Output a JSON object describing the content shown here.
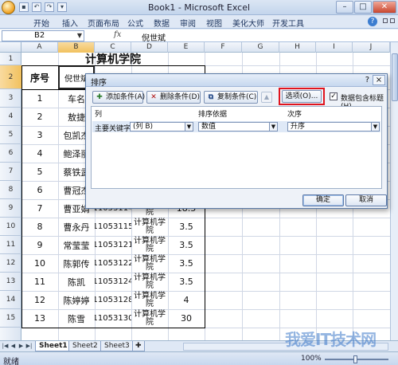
{
  "window": {
    "title": "Book1 - Microsoft Excel"
  },
  "ribbon": {
    "tabs": [
      "开始",
      "插入",
      "页面布局",
      "公式",
      "数据",
      "审阅",
      "视图",
      "美化大师",
      "开发工具"
    ]
  },
  "formula_bar": {
    "name_box": "B2",
    "fx": "fx",
    "value": "倪世斌"
  },
  "columns": [
    "A",
    "B",
    "C",
    "D",
    "E",
    "F",
    "G",
    "H",
    "I",
    "J"
  ],
  "rows": [
    "1",
    "2",
    "3",
    "4",
    "5",
    "6",
    "7",
    "8",
    "9",
    "10",
    "11",
    "12",
    "13",
    "14",
    "15"
  ],
  "sheet": {
    "title": "计算机学院",
    "header": [
      "序号",
      "倪世斌"
    ],
    "data_rows": [
      [
        "1",
        "车名",
        "",
        "",
        ""
      ],
      [
        "2",
        "敖捷",
        "",
        "",
        ""
      ],
      [
        "3",
        "包凯杰",
        "",
        "",
        ""
      ],
      [
        "4",
        "鲍泽丽",
        "",
        "",
        ""
      ],
      [
        "5",
        "蔡铁武",
        "",
        "",
        ""
      ],
      [
        "6",
        "曹冠杰",
        "",
        "",
        ""
      ],
      [
        "7",
        "曹亚娟",
        "11053114",
        "计算机学院",
        "18.5"
      ],
      [
        "8",
        "曹永丹",
        "11053115",
        "计算机学院",
        "3.5"
      ],
      [
        "9",
        "常莹莹",
        "11053121",
        "计算机学院",
        "3.5"
      ],
      [
        "10",
        "陈郭传",
        "11053122",
        "计算机学院",
        "3.5"
      ],
      [
        "11",
        "陈凯",
        "11053124",
        "计算机学院",
        "3.5"
      ],
      [
        "12",
        "陈婷婷",
        "11053128",
        "计算机学院",
        "4"
      ],
      [
        "13",
        "陈雪",
        "11053130",
        "计算机学院",
        "30"
      ]
    ]
  },
  "sheet_tabs": [
    "Sheet1",
    "Sheet2",
    "Sheet3"
  ],
  "status": {
    "mode": "就绪",
    "zoom": "100%"
  },
  "watermark": "我爱IT技术网",
  "dialog": {
    "title": "排序",
    "help": "?",
    "close": "×",
    "add_level": "添加条件(A)",
    "delete_level": "删除条件(D)",
    "copy_level": "复制条件(C)",
    "options": "选项(O)...",
    "has_headers": "数据包含标题(H)",
    "col_header": "列",
    "sort_on_header": "排序依据",
    "order_header": "次序",
    "primary_key_label": "主要关键字",
    "column_value": "(列 B)",
    "sort_on_value": "数值",
    "order_value": "升序",
    "ok": "确定",
    "cancel": "取消"
  }
}
